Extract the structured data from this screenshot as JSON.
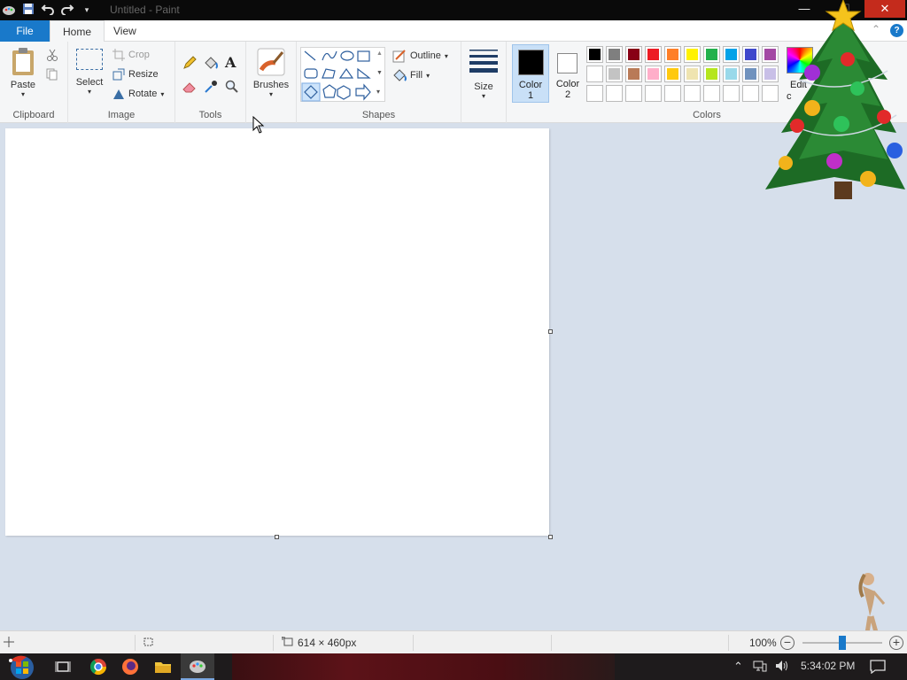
{
  "window": {
    "title": "Untitled - Paint",
    "minimize_glyph": "—",
    "maximize_glyph": "☐",
    "close_glyph": "✕"
  },
  "qat": {
    "app_icon": "paint-icon",
    "save_icon": "save-icon",
    "undo_icon": "undo-icon",
    "redo_icon": "redo-icon",
    "customize_icon": "dropdown-icon"
  },
  "menu": {
    "file": "File",
    "tabs": [
      "Home",
      "View"
    ],
    "collapse_glyph": "⌃",
    "help_glyph": "?"
  },
  "ribbon": {
    "clipboard": {
      "label": "Clipboard",
      "paste": "Paste",
      "cut_icon": "scissors-icon",
      "copy_icon": "copy-icon"
    },
    "image": {
      "label": "Image",
      "select": "Select",
      "crop": "Crop",
      "resize": "Resize",
      "rotate": "Rotate"
    },
    "tools": {
      "label": "Tools",
      "text_glyph": "A"
    },
    "brushes": {
      "label": "Brushes"
    },
    "shapes": {
      "label": "Shapes",
      "outline": "Outline",
      "fill": "Fill"
    },
    "size": {
      "label": "Size"
    },
    "colors": {
      "label": "Colors",
      "color1_label": "Color",
      "color1_num": "1",
      "color2_label": "Color",
      "color2_num": "2",
      "edit_colors": "Edit",
      "edit_colors_line2": "c",
      "color1_value": "#000000",
      "color2_value": "#ffffff",
      "row1": [
        "#000000",
        "#7f7f7f",
        "#880015",
        "#ed1c24",
        "#ff7f27",
        "#fff200",
        "#22b14c",
        "#00a2e8",
        "#3f48cc",
        "#a349a4"
      ],
      "row2": [
        "#ffffff",
        "#c3c3c3",
        "#b97a57",
        "#ffaec9",
        "#ffc90e",
        "#efe4b0",
        "#b5e61d",
        "#99d9ea",
        "#7092be",
        "#c8bfe7"
      ],
      "row3": [
        "",
        "",
        "",
        "",
        "",
        "",
        "",
        "",
        "",
        ""
      ]
    }
  },
  "statusbar": {
    "dimensions": "614 × 460px",
    "zoom": "100%",
    "zoom_fraction": 0.5
  },
  "taskbar": {
    "clock": "5:34:02 PM"
  }
}
